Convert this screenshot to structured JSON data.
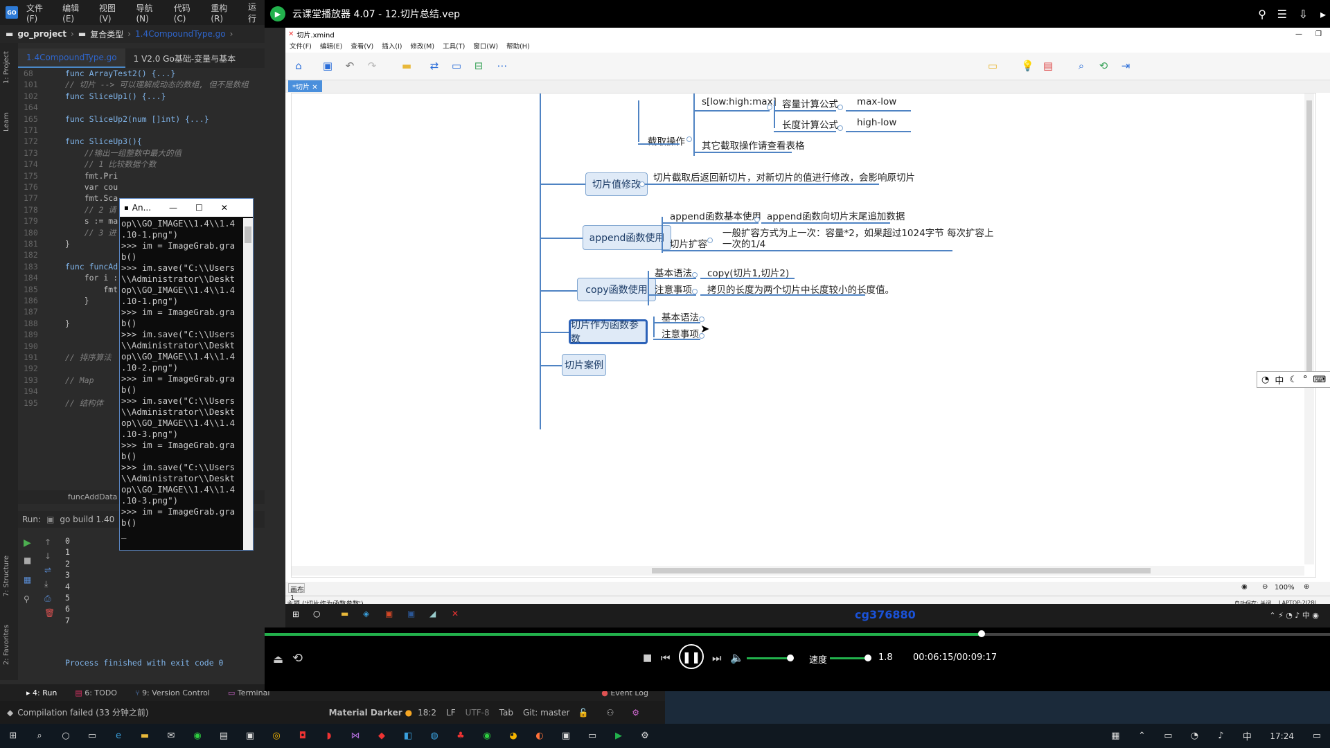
{
  "ide": {
    "menu": [
      "文件(F)",
      "编辑(E)",
      "视图(V)",
      "导航(N)",
      "代码(C)",
      "重构(R)",
      "运行"
    ],
    "breadcrumb": [
      "go_project",
      "复合类型",
      "1.4CompoundType.go"
    ],
    "tabs": [
      "1.4CompoundType.go",
      "1 V2.0 Go基础-变量与基本"
    ],
    "side_tabs": [
      "1: Project",
      "Learn",
      "7: Structure",
      "2: Favorites"
    ],
    "code_lines": [
      {
        "n": "68",
        "t": "func ArrayTest2() {...}"
      },
      {
        "n": "101",
        "t": "// 切片 --> 可以理解成动态的数组, 但不是数组"
      },
      {
        "n": "102",
        "t": "func SliceUp1() {...}"
      },
      {
        "n": "164",
        "t": ""
      },
      {
        "n": "165",
        "t": "func SliceUp2(num []int) {...}"
      },
      {
        "n": "171",
        "t": ""
      },
      {
        "n": "172",
        "t": "func SliceUp3(){"
      },
      {
        "n": "173",
        "t": "    //输出一组整数中最大的值"
      },
      {
        "n": "174",
        "t": "    // 1 比较数据个数"
      },
      {
        "n": "175",
        "t": "    fmt.Pri"
      },
      {
        "n": "176",
        "t": "    var cou"
      },
      {
        "n": "177",
        "t": "    fmt.Sca"
      },
      {
        "n": "178",
        "t": "    // 2 请"
      },
      {
        "n": "179",
        "t": "    s := ma"
      },
      {
        "n": "180",
        "t": "    // 3 进"
      },
      {
        "n": "181",
        "t": "}"
      },
      {
        "n": "182",
        "t": ""
      },
      {
        "n": "183",
        "t": "func funcAd"
      },
      {
        "n": "184",
        "t": "    for i :"
      },
      {
        "n": "185",
        "t": "        fmt"
      },
      {
        "n": "186",
        "t": "    }"
      },
      {
        "n": "187",
        "t": ""
      },
      {
        "n": "188",
        "t": "}"
      },
      {
        "n": "189",
        "t": ""
      },
      {
        "n": "190",
        "t": ""
      },
      {
        "n": "191",
        "t": "// 排序算法"
      },
      {
        "n": "192",
        "t": ""
      },
      {
        "n": "193",
        "t": "// Map"
      },
      {
        "n": "194",
        "t": ""
      },
      {
        "n": "195",
        "t": "// 结构体"
      }
    ],
    "editor_breadcrumb": "funcAddData",
    "run_label": "Run:",
    "run_config": "go build 1.40",
    "run_output": [
      "0",
      "1",
      "2",
      "3",
      "4",
      "5",
      "6",
      "7"
    ],
    "process_finished": "Process finished with exit code 0",
    "bottom_tabs": [
      "4: Run",
      "6: TODO",
      "9: Version Control",
      "Terminal"
    ],
    "event_log": "Event Log",
    "status_message": "Compilation failed (33 分钟之前)",
    "theme": "Material Darker",
    "cursor_pos": "18:2",
    "line_sep": "LF",
    "encoding": "UTF-8",
    "indent": "Tab",
    "git": "Git: master"
  },
  "console": {
    "title": "An...",
    "lines": [
      "op\\\\GO_IMAGE\\\\1.4\\\\1.4",
      ".10-1.png\")",
      ">>> im = ImageGrab.gra",
      "b()",
      ">>> im.save(\"C:\\\\Users",
      "\\\\Administrator\\\\Deskt",
      "op\\\\GO_IMAGE\\\\1.4\\\\1.4",
      ".10-1.png\")",
      ">>> im = ImageGrab.gra",
      "b()",
      ">>> im.save(\"C:\\\\Users",
      "\\\\Administrator\\\\Deskt",
      "op\\\\GO_IMAGE\\\\1.4\\\\1.4",
      ".10-2.png\")",
      ">>> im = ImageGrab.gra",
      "b()",
      ">>> im.save(\"C:\\\\Users",
      "\\\\Administrator\\\\Deskt",
      "op\\\\GO_IMAGE\\\\1.4\\\\1.4",
      ".10-3.png\")",
      ">>> im = ImageGrab.gra",
      "b()",
      ">>> im.save(\"C:\\\\Users",
      "\\\\Administrator\\\\Deskt",
      "op\\\\GO_IMAGE\\\\1.4\\\\1.4",
      ".10-3.png\")",
      ">>> im = ImageGrab.gra",
      "b()",
      "_"
    ]
  },
  "player": {
    "title": "云课堂播放器 4.07 - 12.切片总结.vep",
    "speed_label": "速度",
    "speed_value": "1.8",
    "time": "00:06:15/00:09:17",
    "progress": 0.673,
    "watermark": "cg376880"
  },
  "xmind": {
    "window_title": "切片.xmind",
    "menu": [
      "文件(F)",
      "编辑(E)",
      "查看(V)",
      "插入(I)",
      "修改(M)",
      "工具(T)",
      "窗口(W)",
      "帮助(H)"
    ],
    "tab": "*切片",
    "sheet": "画布 1",
    "status_topic": "主题 ('切片作为函数参数')",
    "autosave": "自动保存: 关闭",
    "laptop": "LAPTOP-2J28(",
    "zoom": "100%",
    "ime": "中",
    "nodes": {
      "cut_op": "截取操作",
      "cut_syntax": "s[low:high:max]",
      "cap_formula": "容量计算公式",
      "cap_value": "max-low",
      "len_formula": "长度计算公式",
      "len_value": "high-low",
      "other_cut": "其它截取操作请查看表格",
      "slice_modify": "切片值修改",
      "slice_modify_note": "切片截取后返回新切片，对新切片的值进行修改，会影响原切片",
      "append_use": "append函数使用",
      "append_basic": "append函数基本使用",
      "append_basic_note": "append函数向切片末尾追加数据",
      "slice_grow": "切片扩容",
      "slice_grow_note1": "一般扩容方式为上一次：容量*2，如果超过1024字节 每次扩容上",
      "slice_grow_note2": "一次的1/4",
      "copy_use": "copy函数使用",
      "copy_syntax": "基本语法",
      "copy_syntax_value": "copy(切片1,切片2)",
      "copy_note": "注意事项",
      "copy_note_value": "拷贝的长度为两个切片中长度较小的长度值。",
      "param": "切片作为函数参数",
      "param_syntax": "基本语法",
      "param_note": "注意事项",
      "case": "切片案例"
    }
  },
  "taskbar": {
    "time": "17:24"
  }
}
